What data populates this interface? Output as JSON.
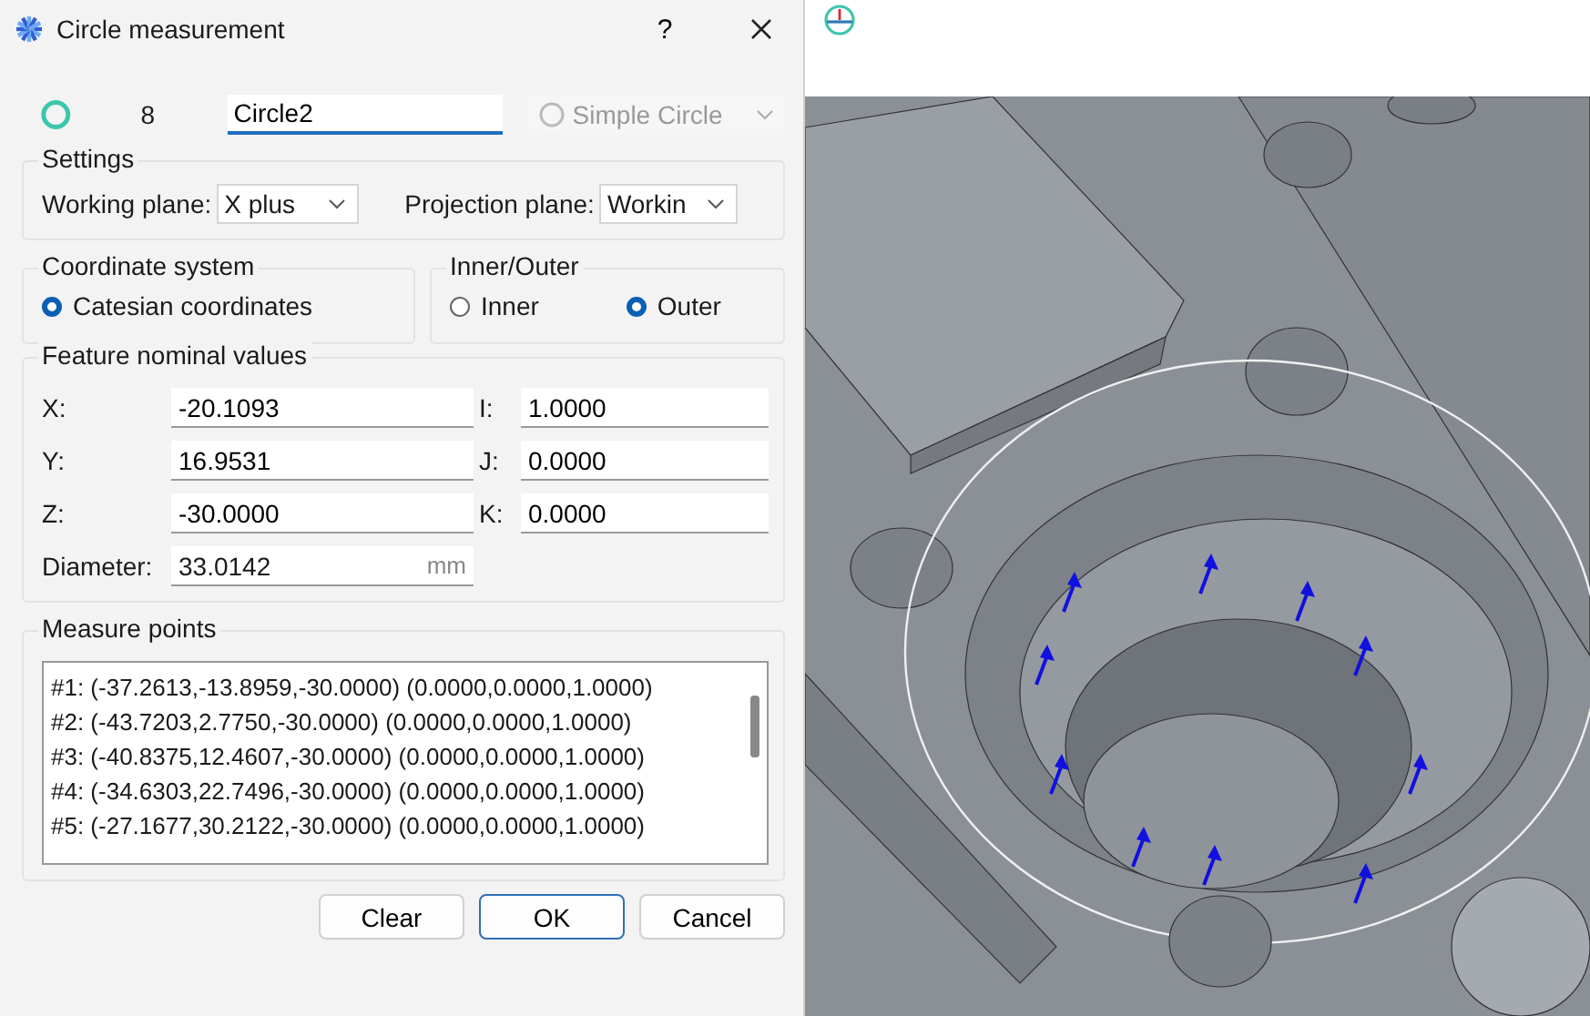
{
  "dialog": {
    "title": "Circle measurement",
    "help": "?"
  },
  "header": {
    "number": "8",
    "name": "Circle2",
    "type": "Simple Circle",
    "type_disabled": true
  },
  "settings": {
    "title": "Settings",
    "working_plane_label": "Working plane:",
    "working_plane": "X plus",
    "projection_plane_label": "Projection plane:",
    "projection_plane": "Workin"
  },
  "coordinate_system": {
    "title": "Coordinate system",
    "options": [
      {
        "label": "Catesian coordinates",
        "selected": true
      }
    ]
  },
  "inner_outer": {
    "title": "Inner/Outer",
    "options": [
      {
        "label": "Inner",
        "selected": false
      },
      {
        "label": "Outer",
        "selected": true
      }
    ]
  },
  "nominal": {
    "title": "Feature nominal values",
    "rows": [
      {
        "label": "X:",
        "value": "-20.1093",
        "dir_label": "I:",
        "dir_value": "1.0000"
      },
      {
        "label": "Y:",
        "value": "16.9531",
        "dir_label": "J:",
        "dir_value": "0.0000"
      },
      {
        "label": "Z:",
        "value": "-30.0000",
        "dir_label": "K:",
        "dir_value": "0.0000"
      }
    ],
    "diameter": {
      "label": "Diameter:",
      "value": "33.0142",
      "unit": "mm"
    }
  },
  "measure_points": {
    "title": "Measure points",
    "rows": [
      "#1: (-37.2613,-13.8959,-30.0000) (0.0000,0.0000,1.0000)",
      "#2: (-43.7203,2.7750,-30.0000) (0.0000,0.0000,1.0000)",
      "#3: (-40.8375,12.4607,-30.0000) (0.0000,0.0000,1.0000)",
      "#4: (-34.6303,22.7496,-30.0000) (0.0000,0.0000,1.0000)",
      "#5: (-27.1677,30.2122,-30.0000) (0.0000,0.0000,1.0000)"
    ]
  },
  "buttons": [
    {
      "label": "Clear",
      "default": false
    },
    {
      "label": "OK",
      "default": true
    },
    {
      "label": "Cancel",
      "default": false
    }
  ]
}
